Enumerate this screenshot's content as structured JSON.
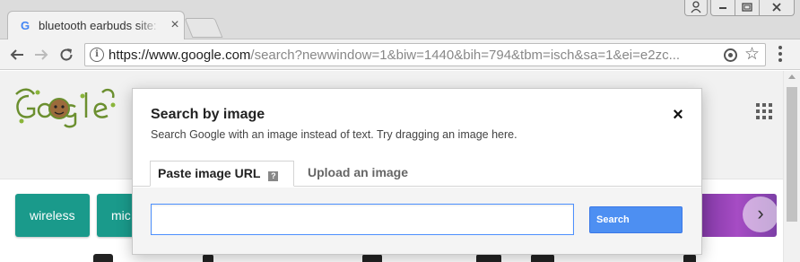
{
  "browser": {
    "tab_title": "bluetooth earbuds site:",
    "tab_favicon": "G",
    "tab_close": "×",
    "url_host": "https://www.google.com",
    "url_rest": "/search?newwindow=1&biw=1440&bih=794&tbm=isch&sa=1&ei=e2zc...",
    "icons": {
      "back": "back-arrow-icon",
      "forward": "forward-arrow-icon",
      "reload": "reload-icon",
      "info": "info-icon",
      "location": "location-target-icon",
      "bookmark": "star-icon",
      "menu": "kebab-menu-icon"
    }
  },
  "page": {
    "chips": [
      {
        "label": "wireless"
      },
      {
        "label": "mic"
      }
    ],
    "chip_color": "#1a9a8b"
  },
  "dialog": {
    "title": "Search by image",
    "subtitle": "Search Google with an image instead of text. Try dragging an image here.",
    "close": "×",
    "tabs": [
      {
        "label": "Paste image URL",
        "active": true
      },
      {
        "label": "Upload an image",
        "active": false
      }
    ],
    "help": "?",
    "url_input": {
      "value": "",
      "placeholder": ""
    },
    "search_label": "Search",
    "accent": "#4d90fe"
  }
}
